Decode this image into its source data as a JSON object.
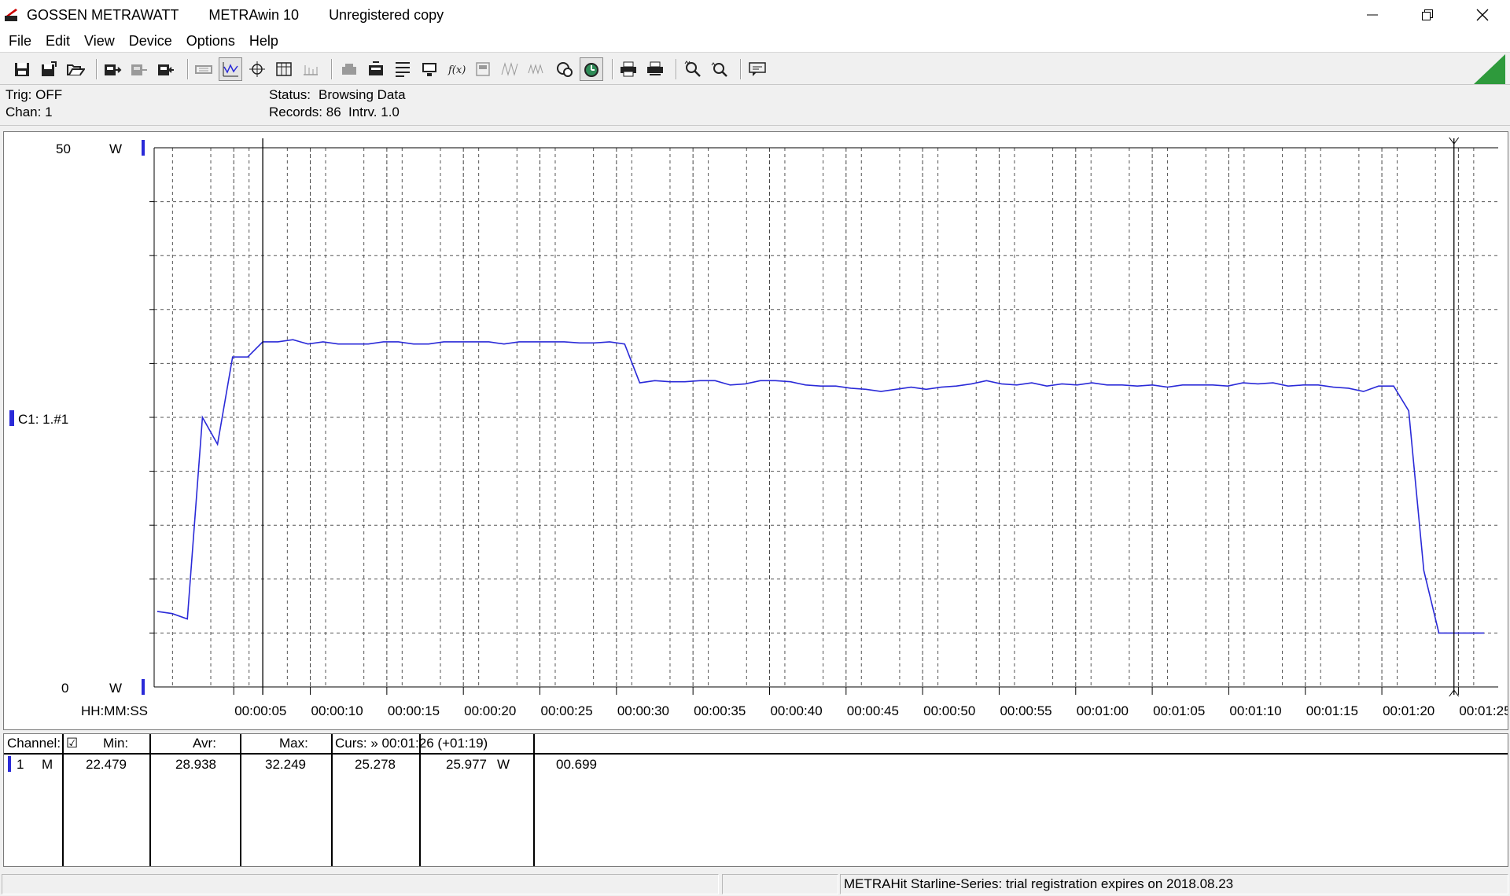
{
  "titlebar": {
    "company": "GOSSEN METRAWATT",
    "app": "METRAwin 10",
    "registration": "Unregistered copy"
  },
  "menu": [
    "File",
    "Edit",
    "View",
    "Device",
    "Options",
    "Help"
  ],
  "toolbar_icons": [
    "save-icon",
    "save-as-icon",
    "open-icon",
    "device-read-icon",
    "device-disabled-icon",
    "device-write-icon",
    "memory-icon",
    "graph-view-icon",
    "cursor-icon",
    "table-view-icon",
    "list-view-icon",
    "settings-icon",
    "channel-config-icon",
    "record-icon",
    "monitor-icon",
    "function-icon",
    "meter-icon",
    "wave-icon",
    "multiwave-icon",
    "trigger-icon",
    "timer-icon",
    "print-icon",
    "print-preview-icon",
    "zoom-in-icon",
    "zoom-out-icon",
    "help-icon"
  ],
  "info": {
    "trig": "Trig: OFF",
    "chan": "Chan:  1",
    "status_label": "Status:",
    "status_value": "Browsing Data",
    "records": "Records: 86",
    "interval": "Intrv. 1.0"
  },
  "graph": {
    "y_max_label": "50",
    "y_min_label": "0",
    "unit": "W",
    "channel_label": "C1: 1.#1",
    "x_axis_title": "HH:MM:SS",
    "line_color": "#2a2ad8",
    "cursor_color": "#000000"
  },
  "chart_data": {
    "type": "line",
    "ylim": [
      0,
      50
    ],
    "xlim": [
      0,
      86
    ],
    "ylabel": "W",
    "xlabel": "HH:MM:SS",
    "x_ticks": [
      {
        "t": 5,
        "label": "00:00:05"
      },
      {
        "t": 10,
        "label": "00:00:10"
      },
      {
        "t": 15,
        "label": "00:00:15"
      },
      {
        "t": 20,
        "label": "00:00:20"
      },
      {
        "t": 25,
        "label": "00:00:25"
      },
      {
        "t": 30,
        "label": "00:00:30"
      },
      {
        "t": 35,
        "label": "00:00:35"
      },
      {
        "t": 40,
        "label": "00:00:40"
      },
      {
        "t": 45,
        "label": "00:00:45"
      },
      {
        "t": 50,
        "label": "00:00:50"
      },
      {
        "t": 55,
        "label": "00:00:55"
      },
      {
        "t": 60,
        "label": "00:01:00"
      },
      {
        "t": 65,
        "label": "00:01:05"
      },
      {
        "t": 70,
        "label": "00:01:10"
      },
      {
        "t": 75,
        "label": "00:01:15"
      },
      {
        "t": 80,
        "label": "00:01:20"
      },
      {
        "t": 85,
        "label": "00:01:25"
      }
    ],
    "cursors": [
      7,
      86
    ],
    "series": [
      {
        "name": "C1: 1.#1",
        "x": [
          0,
          1,
          2,
          3,
          4,
          5,
          6,
          7,
          8,
          9,
          10,
          11,
          12,
          13,
          14,
          15,
          16,
          17,
          18,
          19,
          20,
          21,
          22,
          23,
          24,
          25,
          26,
          27,
          28,
          29,
          30,
          31,
          32,
          33,
          34,
          35,
          36,
          37,
          38,
          39,
          40,
          41,
          42,
          43,
          44,
          45,
          46,
          47,
          48,
          49,
          50,
          51,
          52,
          53,
          54,
          55,
          56,
          57,
          58,
          59,
          60,
          61,
          62,
          63,
          64,
          65,
          66,
          67,
          68,
          69,
          70,
          71,
          72,
          73,
          74,
          75,
          76,
          77,
          78,
          79,
          80,
          81,
          82,
          83,
          84,
          85,
          86,
          87,
          88
        ],
        "y": [
          7.0,
          6.8,
          6.3,
          25.0,
          22.5,
          30.6,
          30.6,
          32.0,
          32.0,
          32.2,
          31.8,
          32.0,
          31.8,
          31.8,
          31.8,
          32.0,
          32.0,
          31.8,
          31.8,
          32.0,
          32.0,
          32.0,
          32.0,
          31.8,
          32.0,
          32.0,
          32.0,
          32.0,
          31.9,
          31.9,
          32.0,
          31.8,
          28.2,
          28.4,
          28.3,
          28.3,
          28.4,
          28.4,
          28.0,
          28.1,
          28.4,
          28.4,
          28.3,
          28.0,
          27.9,
          27.9,
          27.7,
          27.6,
          27.4,
          27.6,
          27.8,
          27.6,
          27.8,
          27.9,
          28.1,
          28.4,
          28.1,
          28.0,
          28.2,
          27.9,
          28.1,
          28.0,
          28.2,
          28.0,
          28.0,
          27.9,
          28.0,
          27.8,
          28.0,
          28.0,
          28.0,
          27.9,
          28.2,
          28.1,
          28.2,
          27.9,
          28.0,
          28.0,
          27.8,
          27.7,
          27.4,
          27.9,
          27.9,
          25.6,
          10.8,
          5.0,
          5.0,
          5.0,
          5.0
        ]
      }
    ]
  },
  "table": {
    "headers": {
      "channel": "Channel:",
      "check": "☑",
      "min": "Min:",
      "avr": "Avr:",
      "max": "Max:",
      "curs": "Curs: » 00:01:26 (+01:19)"
    },
    "row": {
      "channel": "1",
      "mode": "M",
      "min": "22.479",
      "avr": "28.938",
      "max": "32.249",
      "c1": "25.278",
      "c2": "25.977",
      "unit": "W",
      "diff": "00.699"
    }
  },
  "statusbar": {
    "left": "",
    "right": "METRAHit Starline-Series: trial registration expires on 2018.08.23"
  }
}
